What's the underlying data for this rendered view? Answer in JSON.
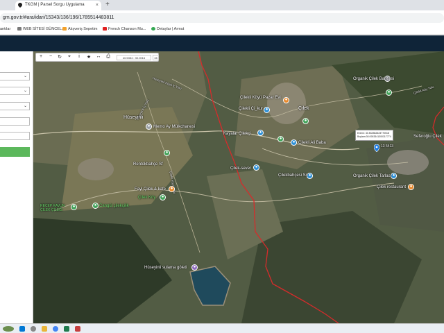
{
  "browser": {
    "tab_title": "TKGM | Parsel Sorgu Uygulama",
    "tab_close": "×",
    "new_tab": "+",
    "url": "gm.gov.tr/#ara/idari/15343/136/196/1785514483811"
  },
  "bookmarks": [
    {
      "label": "antılar",
      "color": "#9aa0a6"
    },
    {
      "label": "WEB SİTESİ GÜNCEL...",
      "color": "#7a7a7a"
    },
    {
      "label": "Alışveriş Sepetim",
      "color": "#f3a12a"
    },
    {
      "label": "French Chanson Mu...",
      "color": "#e02020"
    },
    {
      "label": "Detaylar | Armut",
      "color": "#35a853"
    }
  ],
  "toolbar": {
    "zoom_in": "+",
    "zoom_out": "−",
    "refresh": "↻",
    "locate": "⌖",
    "info": "i",
    "favorite": "★",
    "measure": "↔",
    "print": "⎙",
    "coords": "40.5354 : 30.0016",
    "zoom_level": "15"
  },
  "map": {
    "labels": {
      "huseyinli": "Hüseyinli",
      "cilek": "Çilek",
      "memo_mulk": "Memo Ay Mülkchanesi",
      "cilekli_koy_pazar": "Çilekli Köyü Pazar Evi",
      "cilekli_cicek": "Çilekli Çi_kur",
      "kayalar_cilek": "Kayalar Çilekçi",
      "cilekli_baba": "Çilekli Ali Baba",
      "organik_cilek_bahcesi": "Organik Çilek Bahçesi",
      "sefer_cilek": "Seferoğlu Çilek",
      "rentokbahce": "Rentokbahçe Sf",
      "cilek_sever": "Çilek-sever",
      "cilek_bahcesi_ss": "Çilekbahçesi Ss",
      "organik_cilek_tarlasi": "Organik Çilek Tarlası",
      "cilek_restaurant": "Çilek restaurant",
      "cilek_kafe": "Fayl Çilek & kafe",
      "cilek_koyu": "Çilek Köy",
      "recep_kavun": "RECEP KAVUN ÇİLEK ÇİLEĞİ",
      "cangul": "Cangül çilekçilik",
      "sulama_goleti": "Hüseyinli sulama göleti"
    },
    "road_labels": {
      "road1": "Hüseyinli Köyü İç Yolu",
      "road2": "Hüseyinli İç Yolu",
      "road3": "Çilekli Köyü Yolu",
      "road4": "Çilekli Köy Yolu"
    },
    "popup": {
      "line1": "Enlem: 40.534562623770518",
      "line2": "Boylam:30.0903341300317774"
    },
    "marker_tag": "13 5413"
  },
  "colors": {
    "app_header": "#0f2438",
    "query_button": "#5cb85c",
    "boundary": "#d62b2b",
    "marker": "#1e7be0"
  }
}
